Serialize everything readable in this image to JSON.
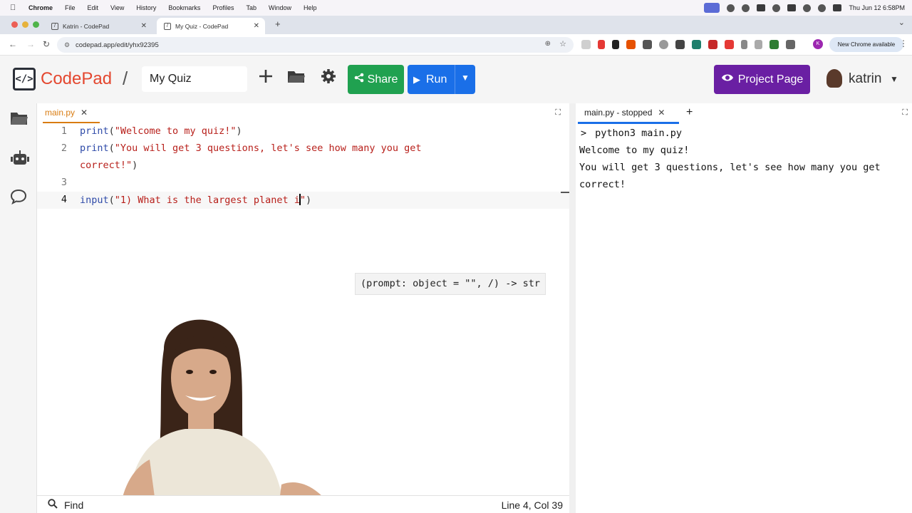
{
  "menubar": {
    "app": "Chrome",
    "items": [
      "File",
      "Edit",
      "View",
      "History",
      "Bookmarks",
      "Profiles",
      "Tab",
      "Window",
      "Help"
    ],
    "clock": "Thu Jun 12  6:58PM"
  },
  "browser": {
    "tabs": [
      {
        "title": "Katrin - CodePad"
      },
      {
        "title": "My Quiz - CodePad"
      }
    ],
    "url": "codepad.app/edit/yhx92395",
    "update_label": "New Chrome available",
    "profile_initial": "K"
  },
  "header": {
    "logo_mark": "</>",
    "brand": "CodePad",
    "separator": "/",
    "project_name": "My Quiz",
    "share_label": "Share",
    "run_label": "Run",
    "project_page_label": "Project Page",
    "username": "katrin"
  },
  "editor": {
    "file_tab": "main.py",
    "lines": [
      {
        "num": "1",
        "fn": "print",
        "arg": "\"Welcome to my quiz!\""
      },
      {
        "num": "2",
        "fn": "print",
        "arg": "\"You will get 3 questions, let's see how many you get",
        "cont": "correct!\""
      },
      {
        "num": "3"
      },
      {
        "num": "4",
        "fn": "input",
        "arg_before_cursor": "\"1) What is the largest planet i",
        "arg_after_cursor": "\""
      }
    ],
    "tooltip": "(prompt: object = \"\", /) -> str",
    "find_label": "Find",
    "cursor_position": "Line 4, Col 39"
  },
  "console": {
    "tab_label": "main.py - stopped",
    "prompt_symbol": ">",
    "command": "python3 main.py",
    "output": [
      "Welcome to my quiz!",
      "You will get 3 questions, let's see how many you get",
      "correct!"
    ]
  },
  "colors": {
    "brand_red": "#e4472f",
    "share_green": "#20a150",
    "run_blue": "#1a6fe8",
    "project_purple": "#6a1fa3",
    "file_tab_orange": "#d97c12"
  }
}
